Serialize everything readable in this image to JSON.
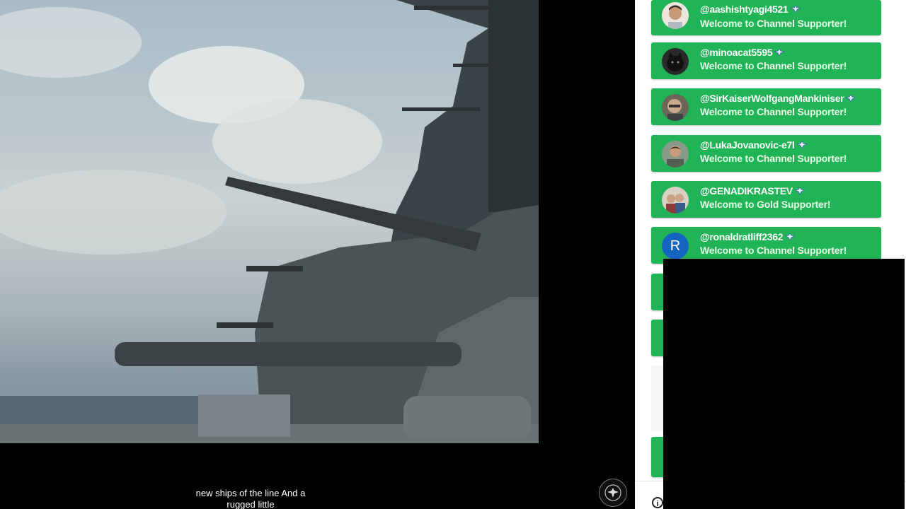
{
  "video": {
    "caption_line1": "new ships of the line And a",
    "caption_line2": "rugged little"
  },
  "chat": {
    "messages": [
      {
        "author": "@aashishtyagi4521",
        "message": "Welcome to Channel Supporter!",
        "avatar": "photo-face"
      },
      {
        "author": "@minoacat5595",
        "message": "Welcome to Channel Supporter!",
        "avatar": "photo-cat"
      },
      {
        "author": "@SirKaiserWolfgangMankiniser",
        "message": "Welcome to Channel Supporter!",
        "avatar": "photo-man"
      },
      {
        "author": "@LukaJovanovic-e7l",
        "message": "Welcome to Channel Supporter!",
        "avatar": "photo-man"
      },
      {
        "author": "@GENADIKRASTEV",
        "message": "Welcome to Gold Supporter!",
        "avatar": "photo-couple"
      },
      {
        "author": "@ronaldratliff2362",
        "message": "Welcome to Channel Supporter!",
        "avatar": "letter-R",
        "avatar_letter": "R"
      }
    ],
    "colors": {
      "membership_green": "#20b456",
      "avatar_blue": "#1565c0"
    }
  },
  "icons": {
    "member_badge": "eagle-badge-icon",
    "info": "info-icon",
    "watermark": "eagle-logo-icon"
  }
}
